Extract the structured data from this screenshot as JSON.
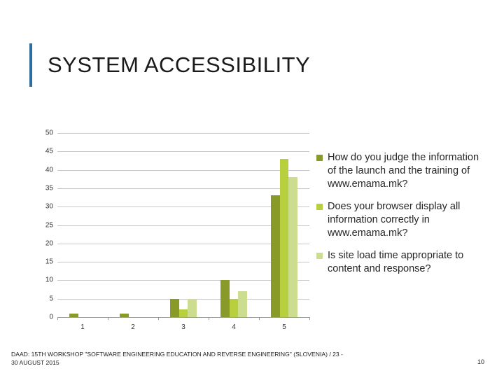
{
  "slide": {
    "title": "SYSTEM ACCESSIBILITY",
    "accent_color": "#2f6d9e",
    "footer_line1": "DAAD: 15TH WORKSHOP \"SOFTWARE ENGINEERING EDUCATION AND REVERSE ENGINEERING\" (SLOVENIA) / 23 -",
    "footer_line2": "30 AUGUST 2015",
    "page_number": "10"
  },
  "chart_data": {
    "type": "bar",
    "title": "",
    "xlabel": "",
    "ylabel": "",
    "categories": [
      "1",
      "2",
      "3",
      "4",
      "5"
    ],
    "ylim": [
      0,
      50
    ],
    "yticks": [
      0,
      5,
      10,
      15,
      20,
      25,
      30,
      35,
      40,
      45,
      50
    ],
    "ytick_labels": [
      "0",
      "5",
      "10",
      "15",
      "20",
      "25",
      "30",
      "35",
      "40",
      "45",
      "50"
    ],
    "grid": true,
    "legend_position": "right",
    "series": [
      {
        "name": "How do you judge the information of the launch and the training of www.emama.mk?",
        "color": "#8a9a28",
        "values": [
          1,
          1,
          5,
          10,
          33
        ]
      },
      {
        "name": "Does your browser display all information correctly in www.emama.mk?",
        "color": "#b8cf3e",
        "values": [
          0,
          0,
          2,
          5,
          43
        ]
      },
      {
        "name": "Is site load time appropriate to content and response?",
        "color": "#ccdd8f",
        "values": [
          0,
          0,
          5,
          7,
          38
        ]
      }
    ]
  }
}
